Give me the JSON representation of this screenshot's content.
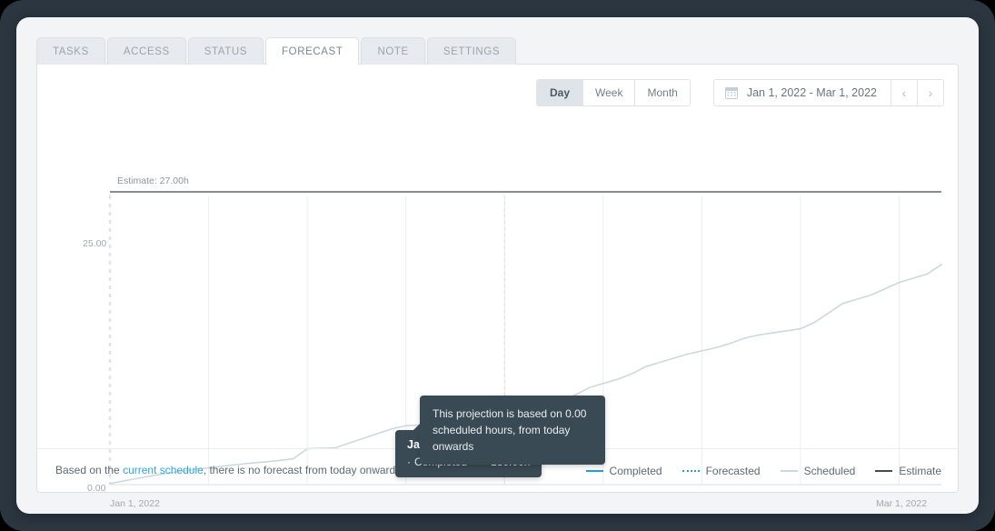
{
  "tabs": [
    {
      "label": "TASKS",
      "active": false
    },
    {
      "label": "ACCESS",
      "active": false
    },
    {
      "label": "STATUS",
      "active": false
    },
    {
      "label": "FORECAST",
      "active": true
    },
    {
      "label": "NOTE",
      "active": false
    },
    {
      "label": "SETTINGS",
      "active": false
    }
  ],
  "toolbar": {
    "granularity": [
      {
        "label": "Day",
        "active": true
      },
      {
        "label": "Week",
        "active": false
      },
      {
        "label": "Month",
        "active": false
      }
    ],
    "date_range": "Jan 1, 2022 - Mar 1, 2022",
    "prev_label": "‹",
    "next_label": "›"
  },
  "chart_tooltip": {
    "date": "Jan 29, 2022",
    "dot": "·",
    "series": "Completed",
    "value": "130.00h"
  },
  "footer": {
    "text_before": "Based on the ",
    "link": "current schedule",
    "text_after": ", there is no forecast from today onwards",
    "info_icon": "i",
    "tooltip": "This projection is based on 0.00 scheduled hours, from today onwards"
  },
  "legend": [
    {
      "label": "Completed",
      "color": "#1da1e3",
      "style": "solid"
    },
    {
      "label": "Forecasted",
      "color": "#1da1e3",
      "style": "dotted"
    },
    {
      "label": "Scheduled",
      "color": "#cdd8de",
      "style": "solid"
    },
    {
      "label": "Estimate",
      "color": "#3e4d57",
      "style": "solid"
    }
  ],
  "chart_data": {
    "type": "line",
    "title": "",
    "xlabel": "",
    "ylabel": "",
    "estimate_annotation": "Estimate: 27.00h",
    "estimate_value": 27.0,
    "x_ticks": [
      "Jan 1, 2022",
      "Mar 1, 2022"
    ],
    "y_ticks": [
      "0.00",
      "25.00"
    ],
    "ylim": [
      0,
      27.8
    ],
    "xlim": [
      "Jan 1, 2022",
      "Mar 1, 2022"
    ],
    "grid": true,
    "legend_position": "bottom-right",
    "series": [
      {
        "name": "Scheduled",
        "color": "#cdd8de",
        "style": "solid",
        "x": [
          "Jan 1",
          "Jan 2",
          "Jan 3",
          "Jan 4",
          "Jan 5",
          "Jan 6",
          "Jan 7",
          "Jan 8",
          "Jan 9",
          "Jan 10",
          "Jan 11",
          "Jan 12",
          "Jan 13",
          "Jan 14",
          "Jan 15",
          "Jan 16",
          "Jan 17",
          "Jan 18",
          "Jan 19",
          "Jan 20",
          "Jan 21",
          "Jan 22",
          "Jan 23",
          "Jan 24",
          "Jan 25",
          "Jan 26",
          "Jan 27",
          "Jan 28",
          "Jan 29",
          "Jan 30",
          "Jan 31",
          "Feb 1",
          "Feb 2",
          "Feb 3",
          "Feb 4",
          "Feb 5",
          "Feb 6",
          "Feb 7",
          "Feb 8",
          "Feb 9",
          "Feb 10",
          "Feb 11",
          "Feb 12",
          "Feb 13",
          "Feb 14",
          "Feb 15",
          "Feb 16",
          "Feb 17",
          "Feb 18",
          "Feb 19",
          "Feb 20",
          "Feb 21",
          "Feb 22",
          "Feb 23",
          "Feb 24",
          "Feb 25",
          "Feb 26",
          "Feb 27",
          "Feb 28",
          "Mar 1"
        ],
        "values": [
          0.1,
          0.35,
          0.6,
          0.85,
          1.05,
          1.25,
          1.45,
          1.6,
          1.75,
          1.9,
          2.05,
          2.15,
          2.3,
          2.45,
          3.4,
          3.45,
          3.5,
          3.95,
          4.4,
          4.85,
          5.3,
          5.6,
          5.65,
          5.7,
          5.75,
          5.8,
          5.85,
          5.9,
          6.3,
          6.7,
          7.0,
          7.4,
          7.9,
          8.5,
          9.2,
          9.6,
          10.0,
          10.5,
          11.2,
          11.6,
          12.0,
          12.4,
          12.7,
          13.0,
          13.4,
          13.9,
          14.2,
          14.4,
          14.6,
          14.8,
          15.4,
          16.3,
          17.2,
          17.6,
          18.0,
          18.6,
          19.2,
          19.6,
          20.0,
          20.9
        ]
      }
    ],
    "hover_point": {
      "x": "Jan 29, 2022",
      "label": "Completed",
      "value": "130.00h"
    }
  }
}
